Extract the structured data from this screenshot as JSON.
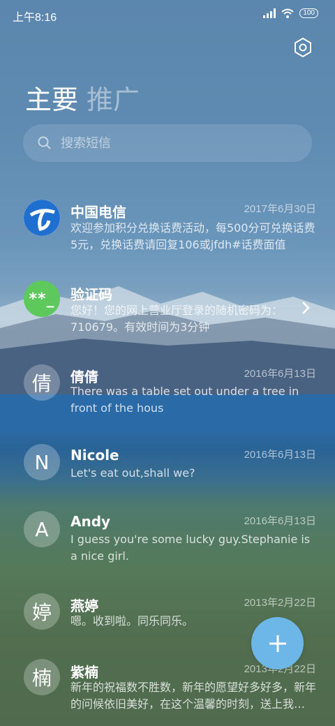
{
  "status_bar": {
    "time": "上午8:16",
    "battery": "100"
  },
  "tabs": [
    {
      "label": "主要"
    },
    {
      "label": "推广"
    }
  ],
  "search": {
    "placeholder": "搜索短信"
  },
  "messages": [
    {
      "sender": "中国电信",
      "date": "2017年6月30日",
      "preview": "欢迎参加积分兑换话费活动，每500分可兑换话费5元，兑换话费请回复106或jfdh#话费面值",
      "avatar": "telecom-logo"
    },
    {
      "sender": "验证码",
      "date": "",
      "preview": "您好！您的网上营业厅登录的随机密码为：710679。有效时间为3分钟",
      "avatar_text": "**_"
    },
    {
      "sender": "倩倩",
      "date": "2016年6月13日",
      "preview": "There was a table set out under a tree in front of the hous",
      "avatar_text": "倩"
    },
    {
      "sender": "Nicole",
      "date": "2016年6月13日",
      "preview": "Let's eat out,shall we?",
      "avatar_text": "N"
    },
    {
      "sender": "Andy",
      "date": "2016年6月13日",
      "preview": "I guess you're some lucky guy.Stephanie is a nice girl.",
      "avatar_text": "A"
    },
    {
      "sender": "燕婷",
      "date": "2013年2月22日",
      "preview": "嗯。收到啦。同乐同乐。",
      "avatar_text": "婷"
    },
    {
      "sender": "紫楠",
      "date": "2013年2月22日",
      "preview": "新年的祝福数不胜数，新年的愿望好多好多，新年的问候依旧美好，在这个温馨的时刻，送上我的祝福",
      "avatar_text": "楠"
    }
  ],
  "fab": {
    "icon": "plus-icon"
  },
  "colors": {
    "fab": "#6db6e8",
    "verify_avatar": "#5dc95c",
    "telecom_blue": "#1f6fd0"
  }
}
